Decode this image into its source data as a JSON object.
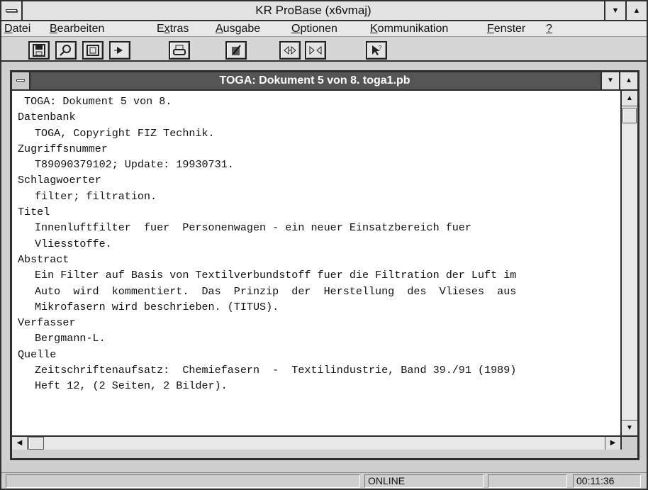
{
  "app": {
    "title": "KR ProBase (x6vmaj)"
  },
  "menu": [
    {
      "label": "Datei"
    },
    {
      "label": "Bearbeiten"
    },
    {
      "label": "Extras"
    },
    {
      "label": "Ausgabe"
    },
    {
      "label": "Optionen"
    },
    {
      "label": "Kommunikation"
    },
    {
      "label": "Fenster"
    },
    {
      "label": "?"
    }
  ],
  "toolbar": {
    "icons": [
      "save-icon",
      "search-icon",
      "window-icon",
      "navigate-icon",
      "print-icon",
      "edit-icon",
      "previous-document-icon",
      "next-document-icon",
      "help-pointer-icon"
    ]
  },
  "document_window": {
    "title": "TOGA: Dokument 5 von 8.  toga1.pb",
    "lines": [
      {
        "text": " TOGA: Dokument 5 von 8.",
        "indent": false
      },
      {
        "text": "Datenbank",
        "indent": false
      },
      {
        "text": "TOGA, Copyright FIZ Technik.",
        "indent": true
      },
      {
        "text": "Zugriffsnummer",
        "indent": false
      },
      {
        "text": "T89090379102; Update: 19930731.",
        "indent": true
      },
      {
        "text": "Schlagwoerter",
        "indent": false
      },
      {
        "text": "filter; filtration.",
        "indent": true
      },
      {
        "text": "Titel",
        "indent": false
      },
      {
        "text": "Innenluftfilter  fuer  Personenwagen - ein neuer Einsatzbereich fuer",
        "indent": true
      },
      {
        "text": "Vliesstoffe.",
        "indent": true
      },
      {
        "text": "Abstract",
        "indent": false
      },
      {
        "text": "Ein Filter auf Basis von Textilverbundstoff fuer die Filtration der Luft im",
        "indent": true
      },
      {
        "text": "Auto  wird  kommentiert.  Das  Prinzip  der  Herstellung  des  Vlieses  aus",
        "indent": true
      },
      {
        "text": "Mikrofasern wird beschrieben. (TITUS).",
        "indent": true
      },
      {
        "text": "Verfasser",
        "indent": false
      },
      {
        "text": "Bergmann-L.",
        "indent": true
      },
      {
        "text": "Quelle",
        "indent": false
      },
      {
        "text": "Zeitschriftenaufsatz:  Chemiefasern  -  Textilindustrie, Band 39./91 (1989)",
        "indent": true
      },
      {
        "text": "Heft 12, (2 Seiten, 2 Bilder).",
        "indent": true
      }
    ]
  },
  "status": {
    "connection": "ONLINE",
    "time": "00:11:36"
  },
  "colors": {
    "child_title_bg": "#555555",
    "document_bg": "#ffffff",
    "chrome_bg": "#cfcfcf"
  }
}
